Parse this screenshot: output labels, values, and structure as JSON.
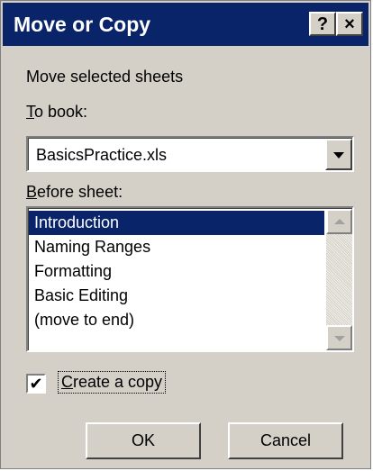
{
  "window": {
    "title": "Move or Copy",
    "help_glyph": "?",
    "close_glyph": "×"
  },
  "instruction": "Move selected sheets",
  "to_book": {
    "label_accel": "T",
    "label_rest": "o book:",
    "value": "BasicsPractice.xls"
  },
  "before_sheet": {
    "label_accel": "B",
    "label_rest": "efore sheet:",
    "items": [
      "Introduction",
      "Naming Ranges",
      "Formatting",
      "Basic Editing",
      "(move to end)"
    ],
    "selected_index": 0
  },
  "create_copy": {
    "checked": true,
    "check_glyph": "✔",
    "label_accel": "C",
    "label_rest": "reate a copy"
  },
  "buttons": {
    "ok": "OK",
    "cancel": "Cancel"
  },
  "colors": {
    "title_bar": "#0a246a",
    "face": "#d4d0c8",
    "selection": "#0a246a"
  },
  "icons": {
    "help": "help-icon",
    "close": "close-icon",
    "dropdown": "chevron-down-icon",
    "scroll_up": "scroll-up-arrow-icon",
    "scroll_down": "scroll-down-arrow-icon",
    "checkmark": "checkmark-icon"
  }
}
